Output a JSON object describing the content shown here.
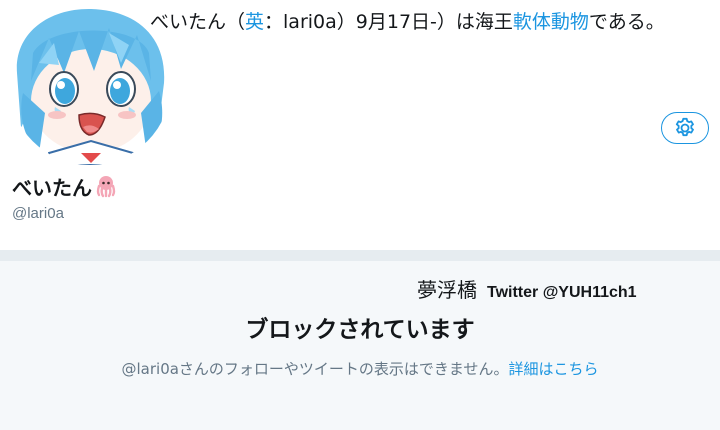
{
  "profile": {
    "bio": {
      "part1": "べいたん（",
      "lang_label": "英",
      "part2": "：lari0a）9月17日-）は海王",
      "link_text": "軟体動物",
      "part3": "である。"
    },
    "display_name": "べいたん",
    "display_name_emoji": "octopus-emoji",
    "handle": "@lari0a",
    "settings_icon": "gear-icon"
  },
  "watermark": {
    "name": "夢浮橋",
    "handle": "Twitter @YUH11ch1"
  },
  "blocked": {
    "title": "ブロックされています",
    "description": "@lari0aさんのフォローやツイートの表示はできません。",
    "link": "詳細はこちら"
  },
  "colors": {
    "accent": "#1b95e0",
    "text_primary": "#14171a",
    "text_secondary": "#657786",
    "panel_bg": "#f5f8fa",
    "divider": "#e6ecf0"
  }
}
